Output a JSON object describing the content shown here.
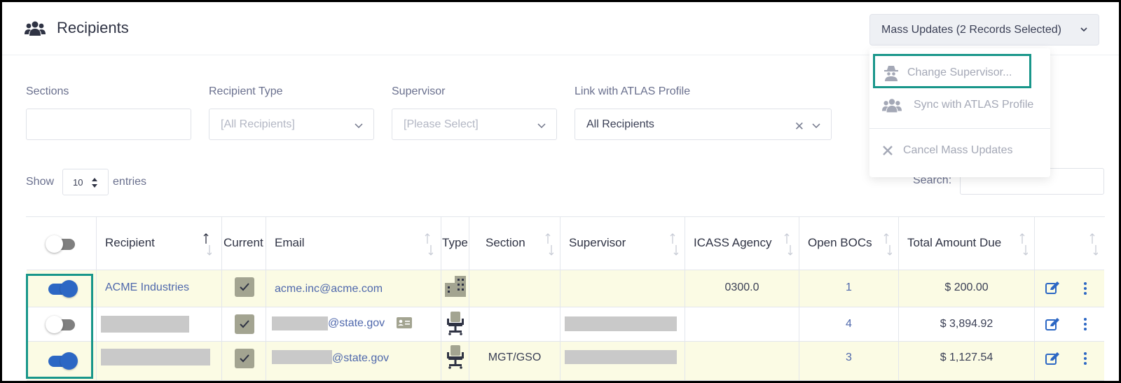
{
  "header": {
    "title": "Recipients",
    "title_icon": "users-icon",
    "mass_updates_label": "Mass Updates (2 Records Selected)"
  },
  "mass_menu": {
    "items": [
      {
        "label": "Change Supervisor...",
        "icon": "spy-icon",
        "highlighted": true
      },
      {
        "label": "Sync with ATLAS Profile",
        "icon": "users-icon",
        "highlighted": false
      },
      {
        "label": "Cancel Mass Updates",
        "icon": "close-icon",
        "highlighted": false
      }
    ]
  },
  "filters": {
    "sections": {
      "label": "Sections",
      "value": ""
    },
    "recipient_type": {
      "label": "Recipient Type",
      "placeholder": "[All Recipients]"
    },
    "supervisor": {
      "label": "Supervisor",
      "placeholder": "[Please Select]"
    },
    "atlas": {
      "label": "Link with ATLAS Profile",
      "value": "All Recipients"
    }
  },
  "list_controls": {
    "show_label": "Show",
    "entries_value": "10",
    "entries_label": "entries",
    "search_label": "Search:"
  },
  "table": {
    "columns": [
      "",
      "Recipient",
      "Current",
      "Email",
      "Type",
      "Section",
      "Supervisor",
      "ICASS Agency",
      "Open BOCs",
      "Total Amount Due",
      ""
    ],
    "rows": [
      {
        "selected": true,
        "recipient": "ACME Industries",
        "current": true,
        "email_user": "",
        "email": "acme.inc@acme.com",
        "type_icon": "building-icon",
        "section": "",
        "supervisor": "",
        "icass_agency": "0300.0",
        "open_bocs": "1",
        "total_due": "$ 200.00"
      },
      {
        "selected": false,
        "recipient": "",
        "current": true,
        "email_user": "",
        "email": "@state.gov",
        "type_icon": "office-chair-icon",
        "section": "",
        "supervisor": "",
        "icass_agency": "",
        "open_bocs": "4",
        "total_due": "$ 3,894.92"
      },
      {
        "selected": true,
        "recipient": "",
        "current": true,
        "email_user": "",
        "email": "@state.gov",
        "type_icon": "office-chair-icon",
        "section": "MGT/GSO",
        "supervisor": "",
        "icass_agency": "",
        "open_bocs": "3",
        "total_due": "$ 1,127.54"
      }
    ]
  },
  "colors": {
    "accent_highlight": "#18968a",
    "toggle_on": "#2c67c4",
    "selected_row_bg": "#fbfbe4",
    "link": "#4f68ac"
  }
}
